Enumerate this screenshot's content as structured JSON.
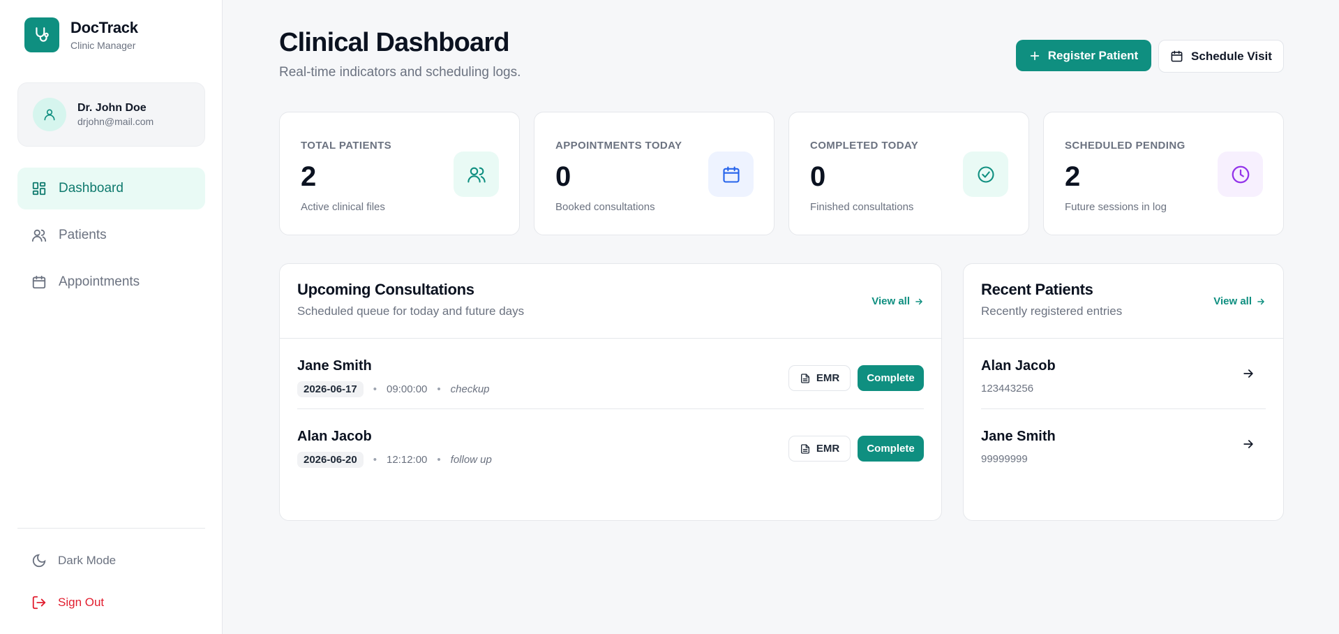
{
  "brand": {
    "name": "DocTrack",
    "subtitle": "Clinic Manager"
  },
  "user": {
    "name": "Dr. John Doe",
    "email": "drjohn@mail.com"
  },
  "sidebar": {
    "items": [
      {
        "label": "Dashboard",
        "icon": "dashboard-grid-icon",
        "active": true
      },
      {
        "label": "Patients",
        "icon": "users-icon",
        "active": false
      },
      {
        "label": "Appointments",
        "icon": "calendar-icon",
        "active": false
      }
    ],
    "dark_mode_label": "Dark Mode",
    "sign_out_label": "Sign Out"
  },
  "header": {
    "title": "Clinical Dashboard",
    "subtitle": "Real-time indicators and scheduling logs.",
    "register_label": "Register Patient",
    "schedule_label": "Schedule Visit"
  },
  "stats": [
    {
      "label": "TOTAL PATIENTS",
      "value": "2",
      "desc": "Active clinical files",
      "icon": "users-icon",
      "color": "#0f8f80",
      "bg": "#e9faf5"
    },
    {
      "label": "APPOINTMENTS TODAY",
      "value": "0",
      "desc": "Booked consultations",
      "icon": "calendar-icon",
      "color": "#2563eb",
      "bg": "#eef3ff"
    },
    {
      "label": "COMPLETED TODAY",
      "value": "0",
      "desc": "Finished consultations",
      "icon": "check-circle-icon",
      "color": "#0f8f80",
      "bg": "#e9faf5"
    },
    {
      "label": "SCHEDULED PENDING",
      "value": "2",
      "desc": "Future sessions in log",
      "icon": "clock-icon",
      "color": "#9333ea",
      "bg": "#f7f0fe"
    }
  ],
  "consultations": {
    "title": "Upcoming Consultations",
    "subtitle": "Scheduled queue for today and future days",
    "view_all": "View all",
    "emr_label": "EMR",
    "complete_label": "Complete",
    "rows": [
      {
        "name": "Jane Smith",
        "date": "2026-06-17",
        "time": "09:00:00",
        "type": "checkup"
      },
      {
        "name": "Alan Jacob",
        "date": "2026-06-20",
        "time": "12:12:00",
        "type": "follow up"
      }
    ]
  },
  "recent_patients": {
    "title": "Recent Patients",
    "subtitle": "Recently registered entries",
    "view_all": "View all",
    "rows": [
      {
        "name": "Alan Jacob",
        "id": "123443256"
      },
      {
        "name": "Jane Smith",
        "id": "99999999"
      }
    ]
  },
  "colors": {
    "accent": "#0f8f80",
    "danger": "#e11d2e",
    "background": "#f6f7f9"
  },
  "separator": "•"
}
